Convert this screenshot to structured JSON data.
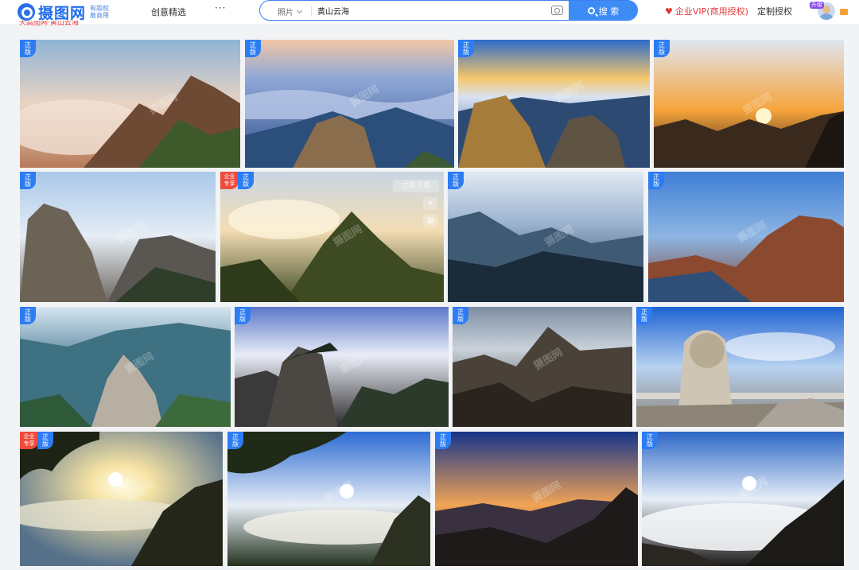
{
  "header": {
    "logo_text": "摄图网",
    "logo_sub_line1": "有版权",
    "logo_sub_line2": "敢商用",
    "nav_featured": "创意精选",
    "nav_more": "···",
    "upgrade_badge": "升级",
    "vip_label": "企业VIP(商用授权)",
    "custom_label": "定制授权"
  },
  "search": {
    "type_label": "照片",
    "query": "黄山云海",
    "button_label": "搜 索"
  },
  "breadcrumb": "天高图网·黄山云海",
  "badges": {
    "genuine": "正版",
    "enterprise": "企业专享"
  },
  "hover": {
    "download_label": "立即下载",
    "star_icon": "star-icon",
    "similar_icon": "similar-icon"
  },
  "watermark": "摄图网",
  "icons": {
    "logo": "camera-logo-icon",
    "heart": "heart-icon",
    "search": "search-icon",
    "camera": "camera-icon",
    "mail": "mail-icon"
  },
  "colors": {
    "brand_blue": "#2d7cf3",
    "vip_red": "#e4393c",
    "enterprise_badge": "#f04a3c"
  }
}
